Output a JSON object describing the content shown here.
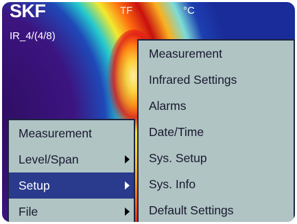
{
  "header": {
    "brand": "SKF",
    "file_id": "IR_4/(4/8)",
    "mode": "TF",
    "unit": "°C"
  },
  "main_menu": {
    "items": [
      {
        "label": "Measurement",
        "has_submenu": false,
        "selected": false
      },
      {
        "label": "Level/Span",
        "has_submenu": true,
        "selected": false
      },
      {
        "label": "Setup",
        "has_submenu": true,
        "selected": true
      },
      {
        "label": "File",
        "has_submenu": true,
        "selected": false
      }
    ]
  },
  "setup_submenu": {
    "items": [
      {
        "label": "Measurement"
      },
      {
        "label": "Infrared Settings"
      },
      {
        "label": "Alarms"
      },
      {
        "label": "Date/Time"
      },
      {
        "label": "Sys. Setup"
      },
      {
        "label": "Sys. Info"
      },
      {
        "label": "Default Settings"
      }
    ]
  },
  "colors": {
    "menu_bg": "#b0c4c4",
    "selected_bg": "#2a3a8c",
    "menu_text": "#18182e",
    "border": "#1c2440"
  }
}
